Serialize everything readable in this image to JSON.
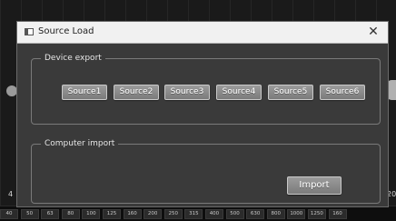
{
  "dialog": {
    "title": "Source Load",
    "close_glyph": "✕"
  },
  "device_export": {
    "legend": "Device export",
    "sources": [
      "Source1",
      "Source2",
      "Source3",
      "Source4",
      "Source5",
      "Source6"
    ]
  },
  "computer_import": {
    "legend": "Computer import",
    "import_label": "Import"
  },
  "background": {
    "left_label": "4",
    "right_label": "20",
    "ruler_ticks": [
      "40",
      "50",
      "63",
      "80",
      "100",
      "125",
      "160",
      "200",
      "250",
      "315",
      "400",
      "500",
      "630",
      "800",
      "1000",
      "1250",
      "160"
    ]
  }
}
